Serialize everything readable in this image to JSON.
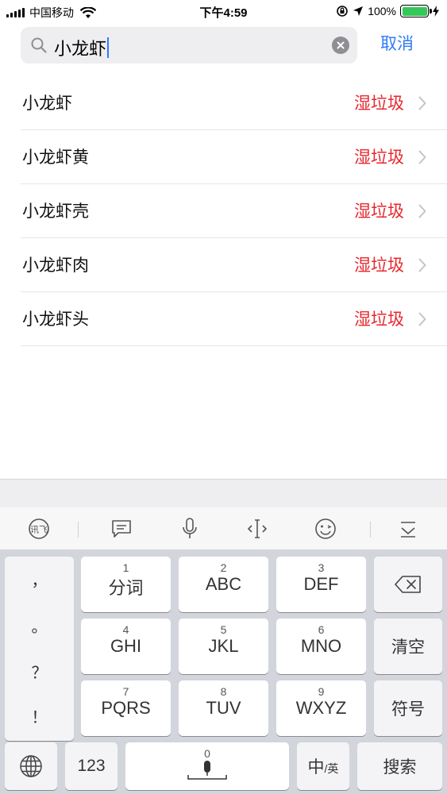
{
  "status_bar": {
    "carrier": "中国移动",
    "time": "下午4:59",
    "battery": "100%"
  },
  "search": {
    "query": "小龙虾",
    "cancel_label": "取消"
  },
  "results": [
    {
      "name": "小龙虾",
      "category": "湿垃圾"
    },
    {
      "name": "小龙虾黄",
      "category": "湿垃圾"
    },
    {
      "name": "小龙虾壳",
      "category": "湿垃圾"
    },
    {
      "name": "小龙虾肉",
      "category": "湿垃圾"
    },
    {
      "name": "小龙虾头",
      "category": "湿垃圾"
    }
  ],
  "keyboard": {
    "toolbar_icons": [
      "ime-logo-icon",
      "chat-icon",
      "microphone-icon",
      "cursor-icon",
      "emoji-icon",
      "collapse-keyboard-icon"
    ],
    "punctuation": [
      "，",
      "。",
      "？",
      "！"
    ],
    "keys": {
      "k1": {
        "num": "1",
        "label": "分词"
      },
      "k2": {
        "num": "2",
        "label": "ABC"
      },
      "k3": {
        "num": "3",
        "label": "DEF"
      },
      "k4": {
        "num": "4",
        "label": "GHI"
      },
      "k5": {
        "num": "5",
        "label": "JKL"
      },
      "k6": {
        "num": "6",
        "label": "MNO"
      },
      "k7": {
        "num": "7",
        "label": "PQRS"
      },
      "k8": {
        "num": "8",
        "label": "TUV"
      },
      "k9": {
        "num": "9",
        "label": "WXYZ"
      },
      "k0": {
        "num": "0"
      }
    },
    "clear_label": "清空",
    "symbols_label": "符号",
    "numbers_label": "123",
    "lang_main": "中",
    "lang_sub": "/英",
    "search_label": "搜索"
  },
  "colors": {
    "accent": "#2f7bf6",
    "category_red": "#e7262c",
    "battery_green": "#34c759"
  }
}
